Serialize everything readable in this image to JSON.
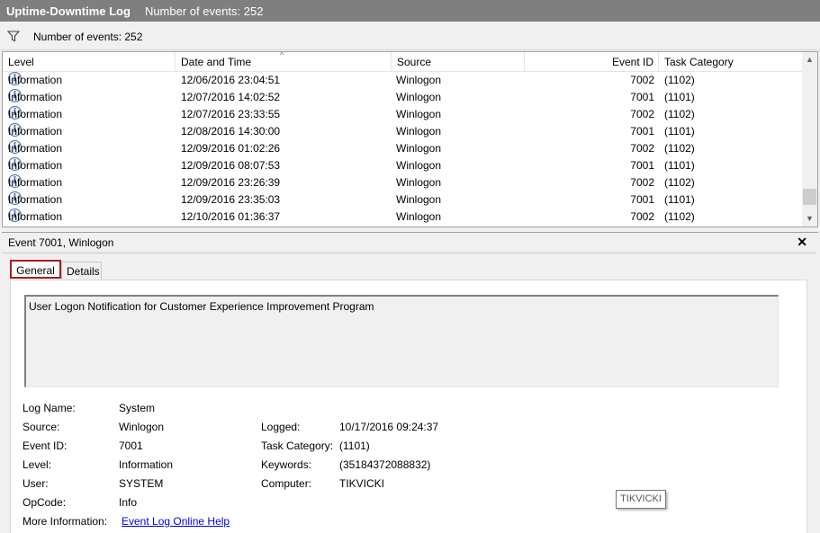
{
  "titlebar": {
    "log_name": "Uptime-Downtime Log",
    "event_count": "Number of events: 252"
  },
  "filterbar": {
    "icon": "filter-icon",
    "label": "Number of events: 252"
  },
  "grid": {
    "columns": [
      "Level",
      "Date and Time",
      "Source",
      "Event ID",
      "Task Category"
    ],
    "sort_indicator": "^",
    "rows": [
      {
        "level": "Information",
        "date": "12/06/2016 23:04:51",
        "source": "Winlogon",
        "id": "7002",
        "category": "(1102)"
      },
      {
        "level": "Information",
        "date": "12/07/2016 14:02:52",
        "source": "Winlogon",
        "id": "7001",
        "category": "(1101)"
      },
      {
        "level": "Information",
        "date": "12/07/2016 23:33:55",
        "source": "Winlogon",
        "id": "7002",
        "category": "(1102)"
      },
      {
        "level": "Information",
        "date": "12/08/2016 14:30:00",
        "source": "Winlogon",
        "id": "7001",
        "category": "(1101)"
      },
      {
        "level": "Information",
        "date": "12/09/2016 01:02:26",
        "source": "Winlogon",
        "id": "7002",
        "category": "(1102)"
      },
      {
        "level": "Information",
        "date": "12/09/2016 08:07:53",
        "source": "Winlogon",
        "id": "7001",
        "category": "(1101)"
      },
      {
        "level": "Information",
        "date": "12/09/2016 23:26:39",
        "source": "Winlogon",
        "id": "7002",
        "category": "(1102)"
      },
      {
        "level": "Information",
        "date": "12/09/2016 23:35:03",
        "source": "Winlogon",
        "id": "7001",
        "category": "(1101)"
      },
      {
        "level": "Information",
        "date": "12/10/2016 01:36:37",
        "source": "Winlogon",
        "id": "7002",
        "category": "(1102)"
      }
    ]
  },
  "detail": {
    "header": "Event 7001, Winlogon",
    "close_glyph": "✕",
    "tabs": [
      "General",
      "Details"
    ],
    "message": "User Logon Notification for Customer Experience Improvement Program",
    "left_props": [
      {
        "label": "Log Name:",
        "value": "System"
      },
      {
        "label": "Source:",
        "value": "Winlogon"
      },
      {
        "label": "Event ID:",
        "value": "7001"
      },
      {
        "label": "Level:",
        "value": "Information"
      },
      {
        "label": "User:",
        "value": "SYSTEM"
      },
      {
        "label": "OpCode:",
        "value": "Info"
      },
      {
        "label": "More Information:",
        "value": "Event Log Online Help"
      }
    ],
    "right_props": [
      {
        "label": "Logged:",
        "value": "10/17/2016 09:24:37"
      },
      {
        "label": "Task Category:",
        "value": "(1101)"
      },
      {
        "label": "Keywords:",
        "value": "(35184372088832)"
      },
      {
        "label": "Computer:",
        "value": "TIKVICKI"
      }
    ]
  },
  "tooltip": {
    "text": "TIKVICKI"
  },
  "colors": {
    "titlebar": "#7f7f7f",
    "selected_tab_border": "#a52020",
    "link": "#0000ee"
  }
}
